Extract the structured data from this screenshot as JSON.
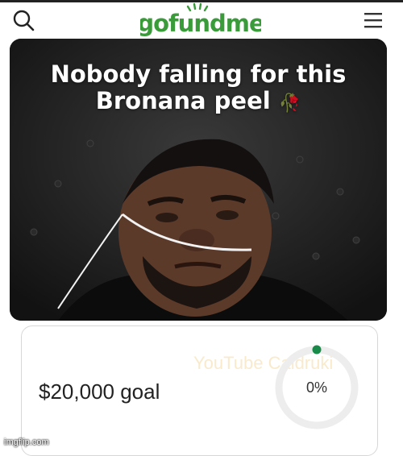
{
  "header": {
    "logo_text": "gofundme",
    "search_icon": "search-icon",
    "menu_icon": "hamburger-menu-icon"
  },
  "meme": {
    "caption_line1": "Nobody falling for this",
    "caption_line2": "Bronana peel",
    "caption_emoji": "🥀"
  },
  "campaign": {
    "goal_label": "$20,000 goal",
    "progress_label": "0%",
    "progress_fraction": 0.0
  },
  "overlays": {
    "watermark": "YouTube Caldruki",
    "imgflip": "imgflip.com"
  },
  "colors": {
    "brand_green": "#3a9b3a",
    "progress_dot": "#1a8a4a",
    "ring_track": "#ededed"
  }
}
